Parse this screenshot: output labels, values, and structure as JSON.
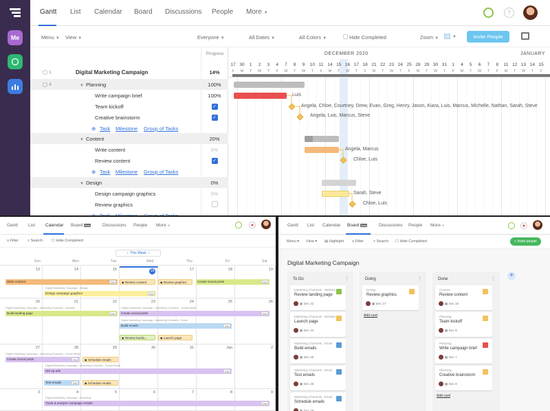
{
  "gantt": {
    "rail": {
      "items": [
        "Me"
      ]
    },
    "nav": {
      "tabs": [
        "Gantt",
        "List",
        "Calendar",
        "Board",
        "Discussions",
        "People",
        "More"
      ]
    },
    "sub": {
      "menu": "Menu",
      "view": "View",
      "everyone": "Everyone",
      "dates": "All Dates",
      "colors": "All Colors",
      "hide": "Hide Completed",
      "zoom": "Zoom",
      "invite": "Invite People"
    },
    "progress_header": "Progress",
    "months": [
      "DECEMBER 2020",
      "JANUARY"
    ],
    "days": [
      "17",
      "30",
      "1",
      "2",
      "3",
      "4",
      "7",
      "8",
      "9",
      "10",
      "11",
      "14",
      "15",
      "16",
      "17",
      "18",
      "21",
      "22",
      "23",
      "24",
      "25",
      "28",
      "29",
      "30",
      "31",
      "1",
      "4",
      "5",
      "6",
      "7",
      "8",
      "11",
      "12",
      "13",
      "14",
      "15"
    ],
    "weekdays": [
      "F",
      "M",
      "T",
      "W",
      "T",
      "F",
      "M",
      "T",
      "W",
      "T",
      "F",
      "M",
      "T",
      "W",
      "T",
      "F",
      "M",
      "T",
      "W",
      "T",
      "F",
      "M",
      "T",
      "W",
      "T",
      "F",
      "M",
      "T",
      "W",
      "T",
      "F",
      "M",
      "T",
      "W",
      "T",
      "F"
    ],
    "rows": [
      {
        "name": "Digital Marketing Campaign",
        "count": "1",
        "progress": "14%",
        "type": "project"
      },
      {
        "name": "Planning",
        "count": "4",
        "progress": "100%",
        "type": "group"
      },
      {
        "name": "Write campaign brief",
        "progress": "100%",
        "type": "task"
      },
      {
        "name": "Team kickoff",
        "type": "check"
      },
      {
        "name": "Creative brainstorm",
        "type": "check"
      },
      {
        "type": "add"
      },
      {
        "name": "Content",
        "progress": "20%",
        "type": "group"
      },
      {
        "name": "Write content",
        "progress": "0%",
        "type": "task"
      },
      {
        "name": "Review content",
        "type": "check"
      },
      {
        "type": "add"
      },
      {
        "name": "Design",
        "progress": "0%",
        "type": "group"
      },
      {
        "name": "Design campaign graphics",
        "progress": "0%",
        "type": "task"
      },
      {
        "name": "Review graphics",
        "type": "uncheck"
      },
      {
        "type": "add"
      }
    ],
    "add_links": {
      "task": "Task",
      "milestone": "Milestone",
      "group": "Group of Tasks"
    },
    "bar_labels": {
      "brief": "Luis",
      "kickoff": "Angela, Chloe, Courtney, Drew, Evan, Greg, Henry, Jason, Kiara, Luis, Marcus, Michelle, Nathan, Sarah, Steve",
      "brainstorm": "Angela, Luis, Marcus, Steve",
      "write": "Angela, Marcus",
      "review": "Chloe, Luis",
      "design": "Sarah, Steve",
      "rgraphics": "Chloe, Luis"
    }
  },
  "calendar": {
    "nav": {
      "tabs": [
        "Gantt",
        "List",
        "Calendar",
        "Board",
        "Discussions",
        "People",
        "More"
      ],
      "beta": "Beta"
    },
    "sub": {
      "filter": "Filter",
      "search": "Search",
      "hide": "Hide Completed"
    },
    "week_label": "This Week",
    "weekdays": [
      "Sun",
      "Mon",
      "Tue",
      "Wed",
      "Thu",
      "Fri",
      "Sat"
    ],
    "weeks": [
      [
        "13",
        "14",
        "15",
        "16",
        "17",
        "18",
        "19"
      ],
      [
        "20",
        "21",
        "22",
        "23",
        "24",
        "25",
        "26"
      ],
      [
        "27",
        "28",
        "29",
        "30",
        "31",
        "Jan",
        "2"
      ],
      [
        "3",
        "4",
        "5",
        "6",
        "7",
        "8",
        "9"
      ]
    ],
    "events": {
      "write_content": "Write content",
      "review_content": "Review content",
      "review_graphics": "Review graphics",
      "create_social": "Create social posts",
      "design_graphics": "Design campaign graphics",
      "build_landing": "Build landing page",
      "create_social2": "Create social posts",
      "build_emails": "Build emails",
      "review_landing": "Review landin...",
      "launch_page": "Launch page",
      "create_social3": "Create social posts",
      "schedule_emails": "Schedule emails",
      "set_up_ads": "Set up ads",
      "test_emails": "Test emails",
      "schedule2": "Schedule emails",
      "track": "Track & analyze campaign results"
    },
    "pcts": [
      "0%",
      "0%",
      "0%",
      "0%",
      "0%",
      "0%",
      "0%",
      "0%",
      "0%",
      "0%"
    ],
    "ev_labels": {
      "a": "Digital Marketing Campaign - Content",
      "b": "Digital Marketing Campaign - Design",
      "c": "Digital Marketing Campaign - Marketing Channels - Website",
      "d": "Digital Marketing Campaign - Marketing Channels - Email",
      "e": "Digital Marketing Campaign - Marketing Channels - Social Media",
      "f": "Digital Marketing Campaign - Reporting"
    }
  },
  "board": {
    "nav": {
      "tabs": [
        "Gantt",
        "List",
        "Calendar",
        "Board",
        "Discussions",
        "People",
        "More"
      ],
      "beta": "Beta"
    },
    "sub": {
      "menu": "Menu",
      "view": "View",
      "highlight": "Highlight",
      "filter": "Filter",
      "search": "Search",
      "hide": "Hide Completed",
      "invite": "Invite people"
    },
    "title": "Digital Marketing Campaign",
    "columns": [
      {
        "name": "To Do",
        "cards": [
          {
            "cat": "Marketing Channels : Website",
            "title": "Review landing page",
            "date": "Dec 22",
            "color": "#8bc34a"
          },
          {
            "cat": "Marketing Channels : Website",
            "title": "Launch page",
            "date": "Dec 24",
            "color": "#f3c25b"
          },
          {
            "cat": "Marketing Channels : Email",
            "title": "Build emails",
            "date": "Dec 25",
            "color": "#5b9bd5"
          },
          {
            "cat": "Marketing Channels : Email",
            "title": "Test emails",
            "date": "Dec 28",
            "color": "#5b9bd5"
          },
          {
            "cat": "Marketing Channels : Email",
            "title": "Schedule emails",
            "date": "Dec 29",
            "color": "#5b9bd5"
          }
        ]
      },
      {
        "name": "Doing",
        "cards": [
          {
            "cat": "Design",
            "title": "Review graphics",
            "date": "Dec 17",
            "color": "#f3c25b"
          }
        ],
        "add": "Add card"
      },
      {
        "name": "Done",
        "cards": [
          {
            "cat": "Content",
            "title": "Review content",
            "date": "Dec 16",
            "color": "#f3c25b"
          },
          {
            "cat": "Planning",
            "title": "Team kickoff",
            "date": "Dec 8",
            "color": "#f3c25b"
          },
          {
            "cat": "Planning",
            "title": "Write campaign brief",
            "date": "Dec 7",
            "color": "#e94f4f"
          },
          {
            "cat": "Planning",
            "title": "Creative brainstorm",
            "date": "Dec 9",
            "color": "#f3c25b"
          }
        ],
        "add": "Add card"
      }
    ],
    "add_todo": "Add card"
  }
}
